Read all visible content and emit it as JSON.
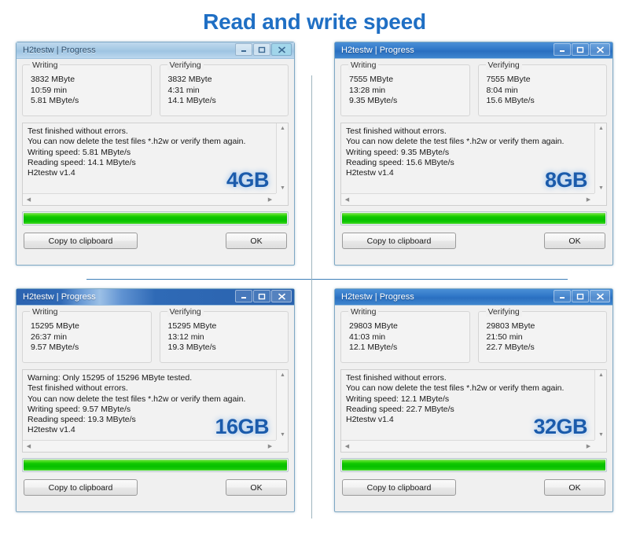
{
  "page": {
    "title": "Read and write speed",
    "title_color": "#1f6fc4",
    "background": "#ffffff",
    "divider_color": "#3e7fb8",
    "progress_color": "#0fc800",
    "capacity_label_color": "#1b5bab"
  },
  "window_common": {
    "title": "H2testw | Progress",
    "writing_group_label": "Writing",
    "verifying_group_label": "Verifying",
    "copy_button_label": "Copy to clipboard",
    "ok_button_label": "OK",
    "minimize_icon": "minimize-icon",
    "maximize_icon": "maximize-icon",
    "close_icon": "close-icon",
    "scroll_up_icon": "scroll-up-arrow-icon",
    "scroll_down_icon": "scroll-down-arrow-icon",
    "scroll_left_icon": "scroll-left-arrow-icon",
    "scroll_right_icon": "scroll-right-arrow-icon",
    "progress_percent": 100
  },
  "windows": [
    {
      "capacity": "4GB",
      "writing": {
        "size": "3832 MByte",
        "time": "10:59 min",
        "speed": "5.81 MByte/s"
      },
      "verifying": {
        "size": "3832 MByte",
        "time": "4:31 min",
        "speed": "14.1 MByte/s"
      },
      "log": [
        "Test finished without errors.",
        "You can now delete the test files *.h2w or verify them again.",
        "Writing speed: 5.81 MByte/s",
        "Reading speed: 14.1 MByte/s",
        "H2testw v1.4"
      ]
    },
    {
      "capacity": "8GB",
      "writing": {
        "size": "7555 MByte",
        "time": "13:28 min",
        "speed": "9.35 MByte/s"
      },
      "verifying": {
        "size": "7555 MByte",
        "time": "8:04 min",
        "speed": "15.6 MByte/s"
      },
      "log": [
        "Test finished without errors.",
        "You can now delete the test files *.h2w or verify them again.",
        "Writing speed: 9.35 MByte/s",
        "Reading speed: 15.6 MByte/s",
        "H2testw v1.4"
      ]
    },
    {
      "capacity": "16GB",
      "writing": {
        "size": "15295 MByte",
        "time": "26:37 min",
        "speed": "9.57 MByte/s"
      },
      "verifying": {
        "size": "15295 MByte",
        "time": "13:12 min",
        "speed": "19.3 MByte/s"
      },
      "log": [
        "Warning: Only 15295 of 15296 MByte tested.",
        "Test finished without errors.",
        "You can now delete the test files *.h2w or verify them again.",
        "Writing speed: 9.57 MByte/s",
        "Reading speed: 19.3 MByte/s",
        "H2testw v1.4"
      ]
    },
    {
      "capacity": "32GB",
      "writing": {
        "size": "29803 MByte",
        "time": "41:03 min",
        "speed": "12.1 MByte/s"
      },
      "verifying": {
        "size": "29803 MByte",
        "time": "21:50 min",
        "speed": "22.7 MByte/s"
      },
      "log": [
        "Test finished without errors.",
        "You can now delete the test files *.h2w or verify them again.",
        "Writing speed: 12.1 MByte/s",
        "Reading speed: 22.7 MByte/s",
        "H2testw v1.4"
      ]
    }
  ]
}
